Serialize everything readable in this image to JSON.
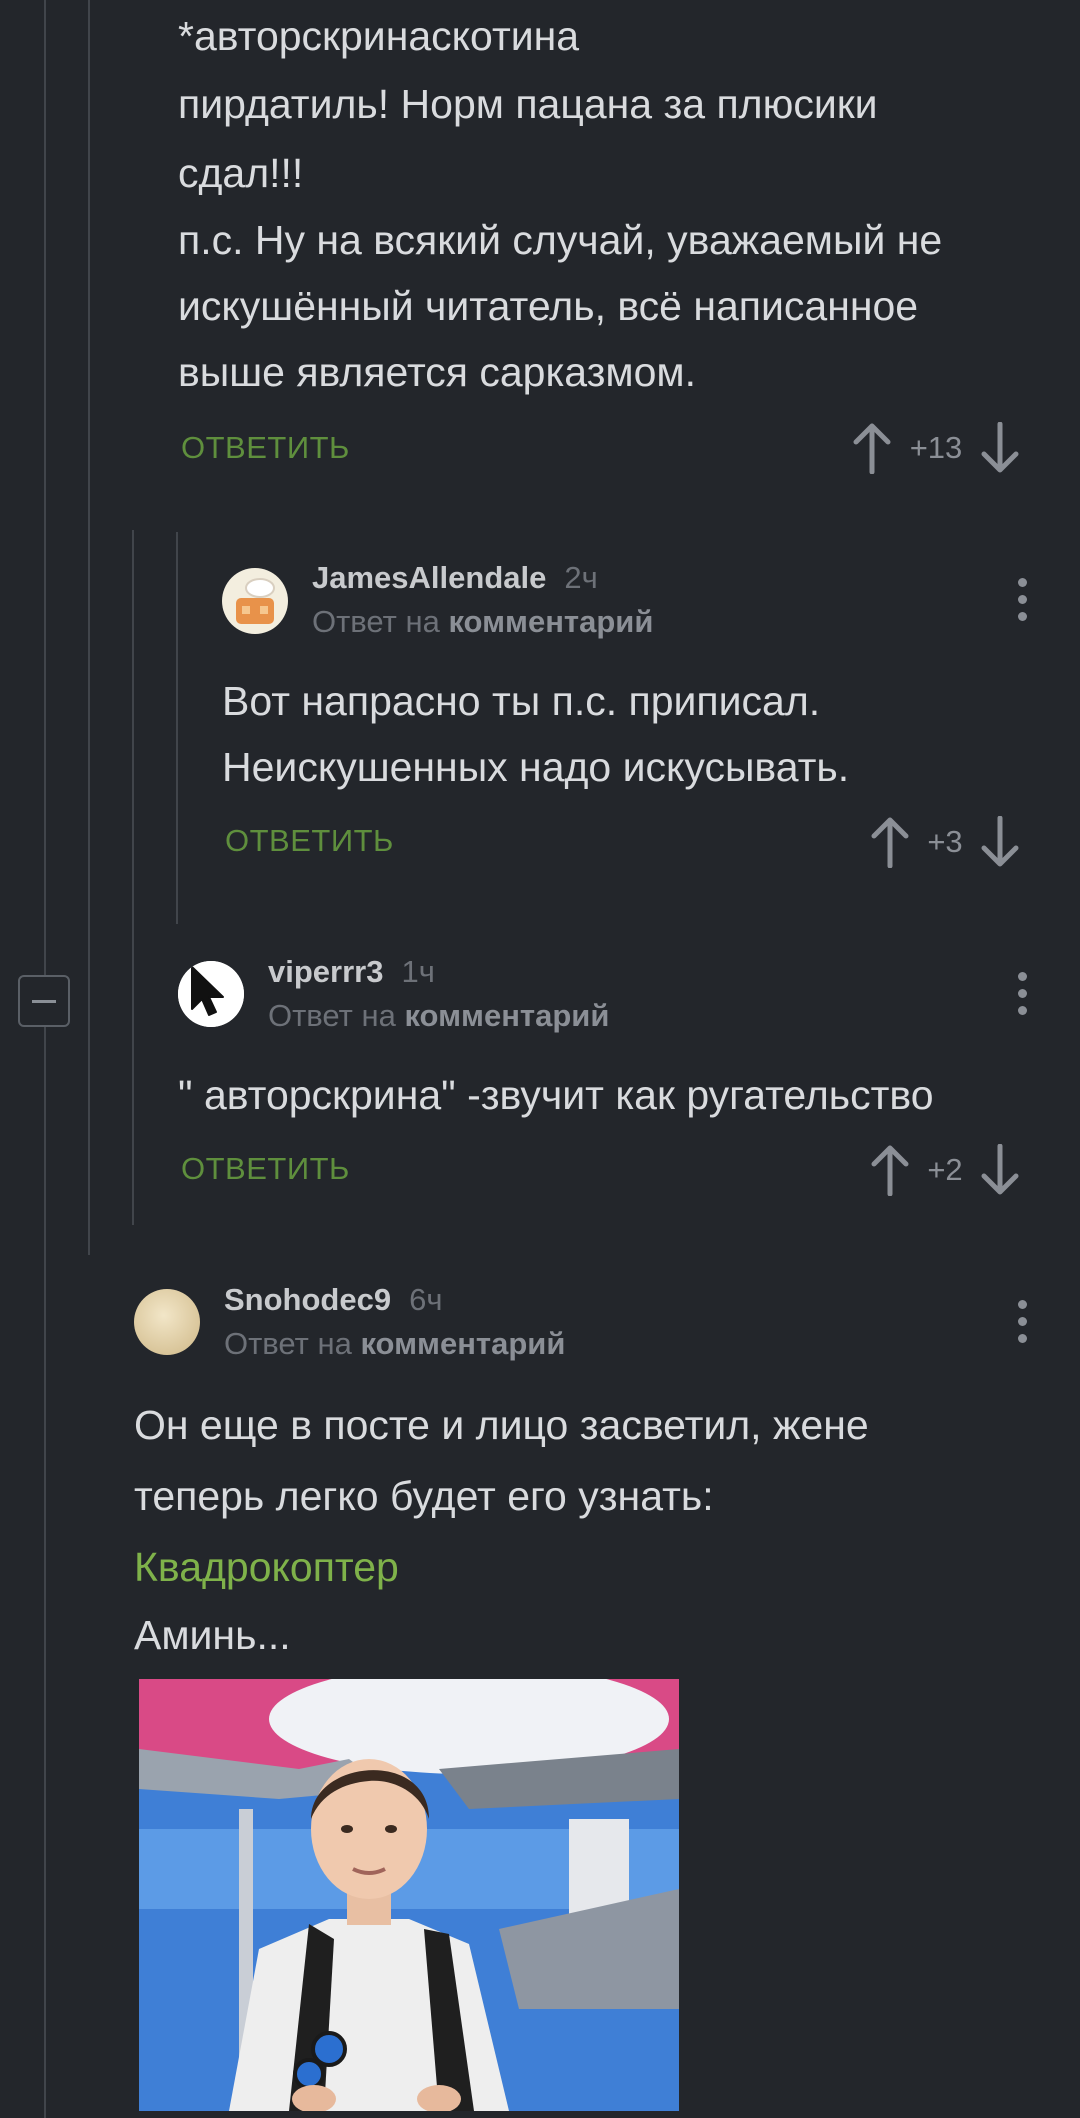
{
  "comments": {
    "top": {
      "lines": [
        "*авторскринаскотина",
        "пирдатиль! Норм пацана за плюсики",
        "сдал!!!",
        "п.с. Ну на всякий случай, уважаемый не",
        "искушённый читатель, всё написанное",
        "выше является сарказмом."
      ],
      "reply_label": "ОТВЕТИТЬ",
      "score": "+13"
    },
    "james": {
      "author": "JamesAllendale",
      "time": "2ч",
      "reply_prefix": "Ответ на",
      "reply_target": "комментарий",
      "lines": [
        "Вот напрасно ты п.с. приписал.",
        "Неискушенных надо искусывать."
      ],
      "reply_label": "ОТВЕТИТЬ",
      "score": "+3"
    },
    "viper": {
      "author": "viperrr3",
      "time": "1ч",
      "reply_prefix": "Ответ на",
      "reply_target": "комментарий",
      "lines": [
        "\" авторскрина\" -звучит как ругательство"
      ],
      "reply_label": "ОТВЕТИТЬ",
      "score": "+2"
    },
    "snohodec": {
      "author": "Snohodec9",
      "time": "6ч",
      "reply_prefix": "Ответ на",
      "reply_target": "комментарий",
      "lines": [
        "Он еще в посте и лицо засветил, жене",
        "теперь легко будет его узнать:"
      ],
      "link": "Квадрокоптер",
      "after_link": "Аминь..."
    }
  },
  "colors": {
    "background": "#23262b",
    "accent_green": "#7fb24a",
    "reply_green": "#5f8f3d"
  }
}
